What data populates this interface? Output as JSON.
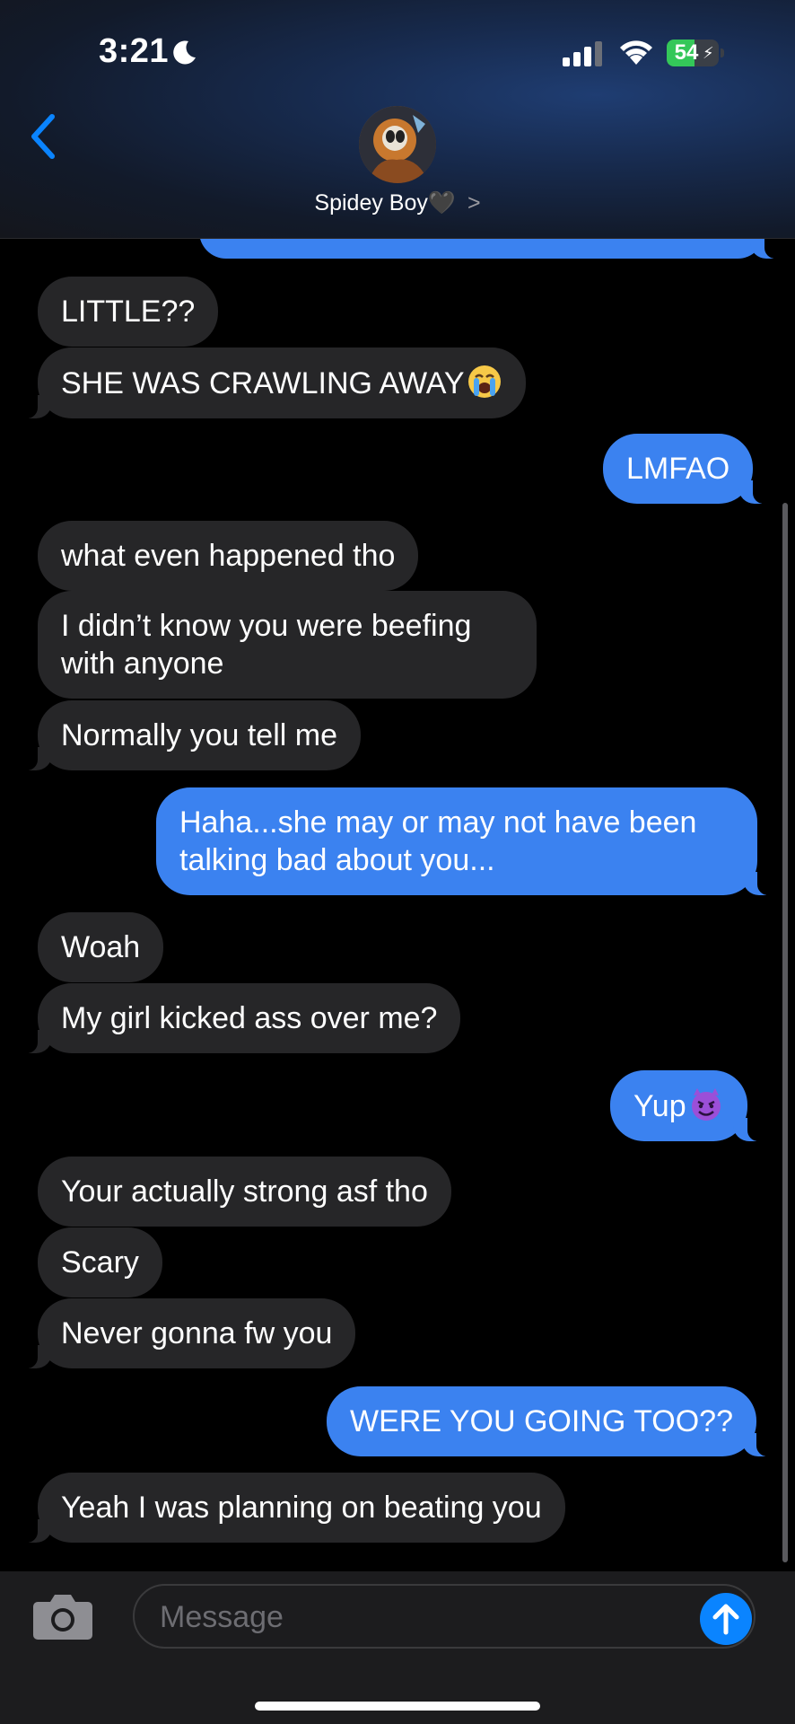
{
  "status_bar": {
    "time": "3:21",
    "battery": "54",
    "battery_level": 0.54
  },
  "header": {
    "contact_name": "Spidey Boy🖤",
    "chevron": ">"
  },
  "messages": [
    {
      "side": "sent",
      "text": ""
    },
    {
      "side": "received",
      "text": "LITTLE??"
    },
    {
      "side": "received",
      "text": "SHE WAS CRAWLING AWAY",
      "emoji": "loudly-crying-face"
    },
    {
      "side": "sent",
      "text": "LMFAO"
    },
    {
      "side": "received",
      "text": "what even happened tho"
    },
    {
      "side": "received",
      "text": "I didn’t know you were beefing with anyone"
    },
    {
      "side": "received",
      "text": "Normally you tell me"
    },
    {
      "side": "sent",
      "text": "Haha...she may or may not have been talking bad about you..."
    },
    {
      "side": "received",
      "text": "Woah"
    },
    {
      "side": "received",
      "text": "My girl kicked ass over me?"
    },
    {
      "side": "sent",
      "text": "Yup",
      "emoji": "smiling-devil-face"
    },
    {
      "side": "received",
      "text": "Your actually strong asf tho"
    },
    {
      "side": "received",
      "text": "Scary"
    },
    {
      "side": "received",
      "text": "Never gonna fw you"
    },
    {
      "side": "sent",
      "text": "WERE YOU GOING TOO??"
    },
    {
      "side": "received",
      "text": "Yeah I was planning on beating you"
    }
  ],
  "composer": {
    "placeholder": "Message"
  },
  "colors": {
    "sent_bubble": "#3b82f0",
    "received_bubble": "#262628",
    "accent": "#0a84ff"
  }
}
